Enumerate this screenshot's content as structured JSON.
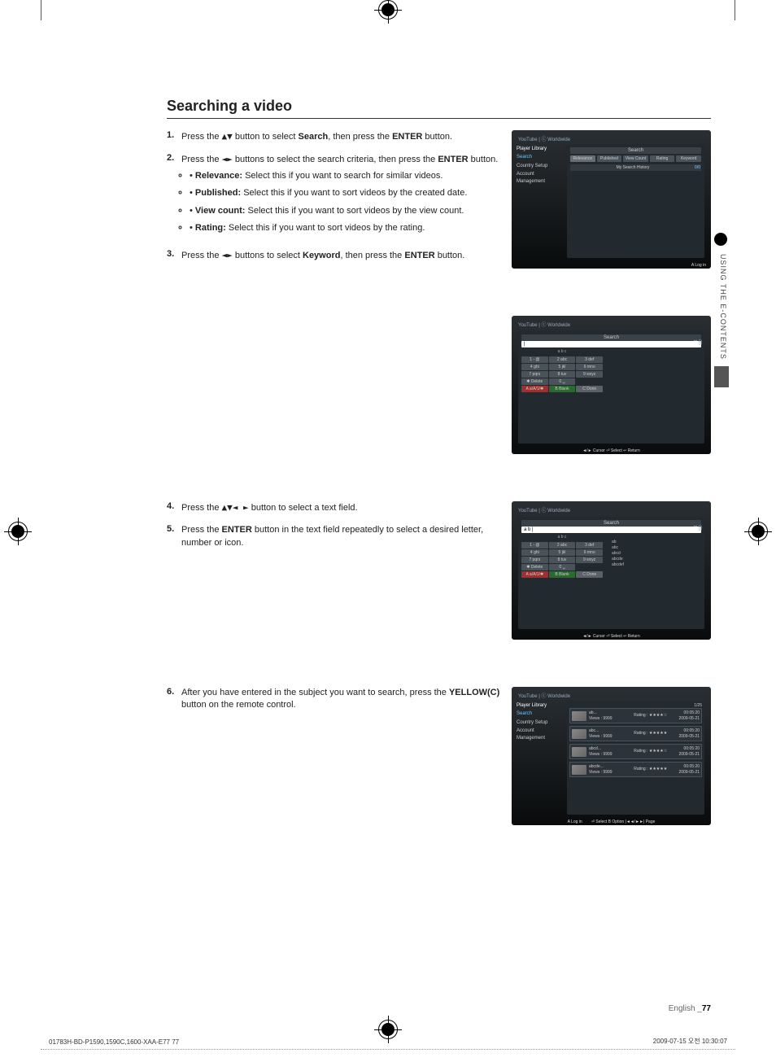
{
  "heading": "Searching a video",
  "steps": [
    {
      "num": "1.",
      "text": "Press the ▲▼ button to select <b>Search</b>, then press the <b>ENTER</b> button."
    },
    {
      "num": "2.",
      "text": "Press the ◄► buttons to select the search criteria, then press the <b>ENTER</b> button.",
      "bullets": [
        {
          "label": "Relevance:",
          "desc": "Select this if you want to search for similar videos."
        },
        {
          "label": "Published:",
          "desc": "Select this if you want to sort videos by the created date."
        },
        {
          "label": "View count:",
          "desc": "Select this if you want to sort videos by the view count."
        },
        {
          "label": "Rating:",
          "desc": "Select this if you want to sort videos by the rating."
        }
      ]
    },
    {
      "num": "3.",
      "text": "Press the ◄► buttons to select <b>Keyword</b>, then press the <b>ENTER</b> button."
    },
    {
      "num": "4.",
      "text": "Press the ▲▼◄ ► button to select a text field."
    },
    {
      "num": "5.",
      "text": "Press the <b>ENTER</b> button in the text field repeatedly to select a desired letter, number or icon."
    },
    {
      "num": "6.",
      "text": "After you have entered in the subject you want to search, press the <b>YELLOW(C)</b> button on the remote control."
    }
  ],
  "sideTab": {
    "label": "USING THE E-CONTENTS"
  },
  "footer": {
    "lang": "English",
    "page": "77"
  },
  "printFooter": {
    "left": "01783H-BD-P1590,1590C,1600-XAA-E77   77",
    "right": "2009-07-15   오전 10:30:07"
  },
  "ss_header": "YouTube | ⓒ Worldwide",
  "sidebar_items": [
    "Player Library",
    "Search",
    "Country Setup",
    "Account Management"
  ],
  "ss1": {
    "title": "Search",
    "tabs": [
      "Relevance",
      "Published",
      "View Count",
      "Rating",
      "Keyword"
    ],
    "history": "My Search History",
    "hist_count": "0/0",
    "footer": "A Log in"
  },
  "keypad": {
    "input_empty": "|",
    "input_text": "a b |",
    "abc": "a b c",
    "keys": [
      [
        "1   - @",
        "2   abc",
        "3   def"
      ],
      [
        "4   ghi",
        "5   jkl",
        "6   mno"
      ],
      [
        "7   pqrs",
        "8   tuv",
        "9   wxyz"
      ],
      [
        "✱  Delete",
        "0   ␣",
        ""
      ]
    ],
    "actions": [
      "A a/A/1/✱",
      "B Blank",
      "C Done"
    ],
    "hints": [
      "ab",
      "abc",
      "abcd",
      "abcde",
      "abcdef"
    ],
    "footer": "◄/► Cursor  ⏎ Select  ↩ Return",
    "scroll_page": "/25",
    "scroll_pos": "1"
  },
  "ss4": {
    "count": "1/25",
    "rows": [
      {
        "title": "ab...",
        "views": "Views : 9999",
        "rating": "Rating : ★★★★☆",
        "dur": "00:05:20",
        "date": "2009-05-21"
      },
      {
        "title": "abc...",
        "views": "Views : 9999",
        "rating": "Rating : ★★★★★",
        "dur": "00:05:20",
        "date": "2009-05-21"
      },
      {
        "title": "abcd...",
        "views": "Views : 9999",
        "rating": "Rating : ★★★★☆",
        "dur": "00:05:20",
        "date": "2009-05-21"
      },
      {
        "title": "abcde...",
        "views": "Views : 9999",
        "rating": "Rating : ★★★★★",
        "dur": "00:05:20",
        "date": "2009-05-21"
      }
    ],
    "footerL": "A Log in",
    "footerR": "⏎ Select  B Option  |◄◄/►►| Page"
  }
}
